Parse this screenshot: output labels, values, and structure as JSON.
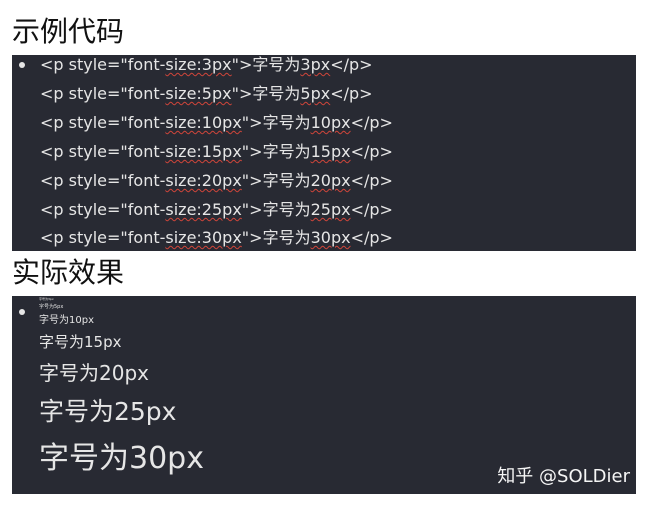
{
  "headings": {
    "code": "示例代码",
    "result": "实际效果"
  },
  "code_lines": [
    {
      "pre": "<p style=\"font-",
      "u1": "size:3px",
      "mid": "\">字号为",
      "u2": "3px",
      "post": "</p>"
    },
    {
      "pre": "<p style=\"font-",
      "u1": "size:5px",
      "mid": "\">字号为",
      "u2": "5px",
      "post": "</p>"
    },
    {
      "pre": "<p style=\"font-",
      "u1": "size:10px",
      "mid": "\">字号为",
      "u2": "10px",
      "post": "</p>"
    },
    {
      "pre": "<p style=\"font-",
      "u1": "size:15px",
      "mid": "\">字号为",
      "u2": "15px",
      "post": "</p>"
    },
    {
      "pre": "<p style=\"font-",
      "u1": "size:20px",
      "mid": "\">字号为",
      "u2": "20px",
      "post": "</p>"
    },
    {
      "pre": "<p style=\"font-",
      "u1": "size:25px",
      "mid": "\">字号为",
      "u2": "25px",
      "post": "</p>"
    },
    {
      "pre": "<p style=\"font-",
      "u1": "size:30px",
      "mid": "\">字号为",
      "u2": "30px",
      "post": "</p>"
    }
  ],
  "samples": [
    {
      "text": "字号为3px"
    },
    {
      "text": "字号为5px"
    },
    {
      "text": "字号为10px"
    },
    {
      "text": "字号为15px"
    },
    {
      "text": "字号为20px"
    },
    {
      "text": "字号为25px"
    },
    {
      "text": "字号为30px"
    }
  ],
  "watermark": "知乎 @SOLDier",
  "colors": {
    "panel_bg": "#282a33",
    "panel_text": "#e6e6e6",
    "spell_underline": "#d0453a"
  }
}
